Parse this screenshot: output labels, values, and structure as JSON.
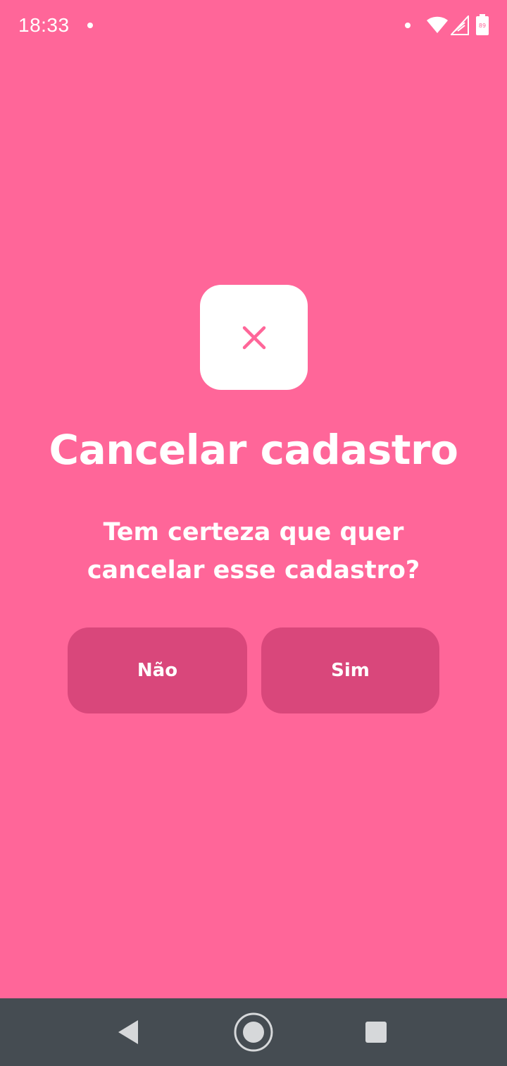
{
  "status_bar": {
    "time": "18:33",
    "battery_level": "89"
  },
  "dialog": {
    "icon": "close-icon",
    "title": "Cancelar cadastro",
    "message": "Tem certeza que quer cancelar esse cadastro?",
    "no_label": "Não",
    "yes_label": "Sim"
  },
  "colors": {
    "background": "#ff6699",
    "button": "#d9477b",
    "card": "#ffffff",
    "icon": "#ff6699",
    "nav_bar": "#454c52"
  },
  "nav_bar": {
    "back": "back-icon",
    "home": "home-icon",
    "recents": "recents-icon"
  }
}
